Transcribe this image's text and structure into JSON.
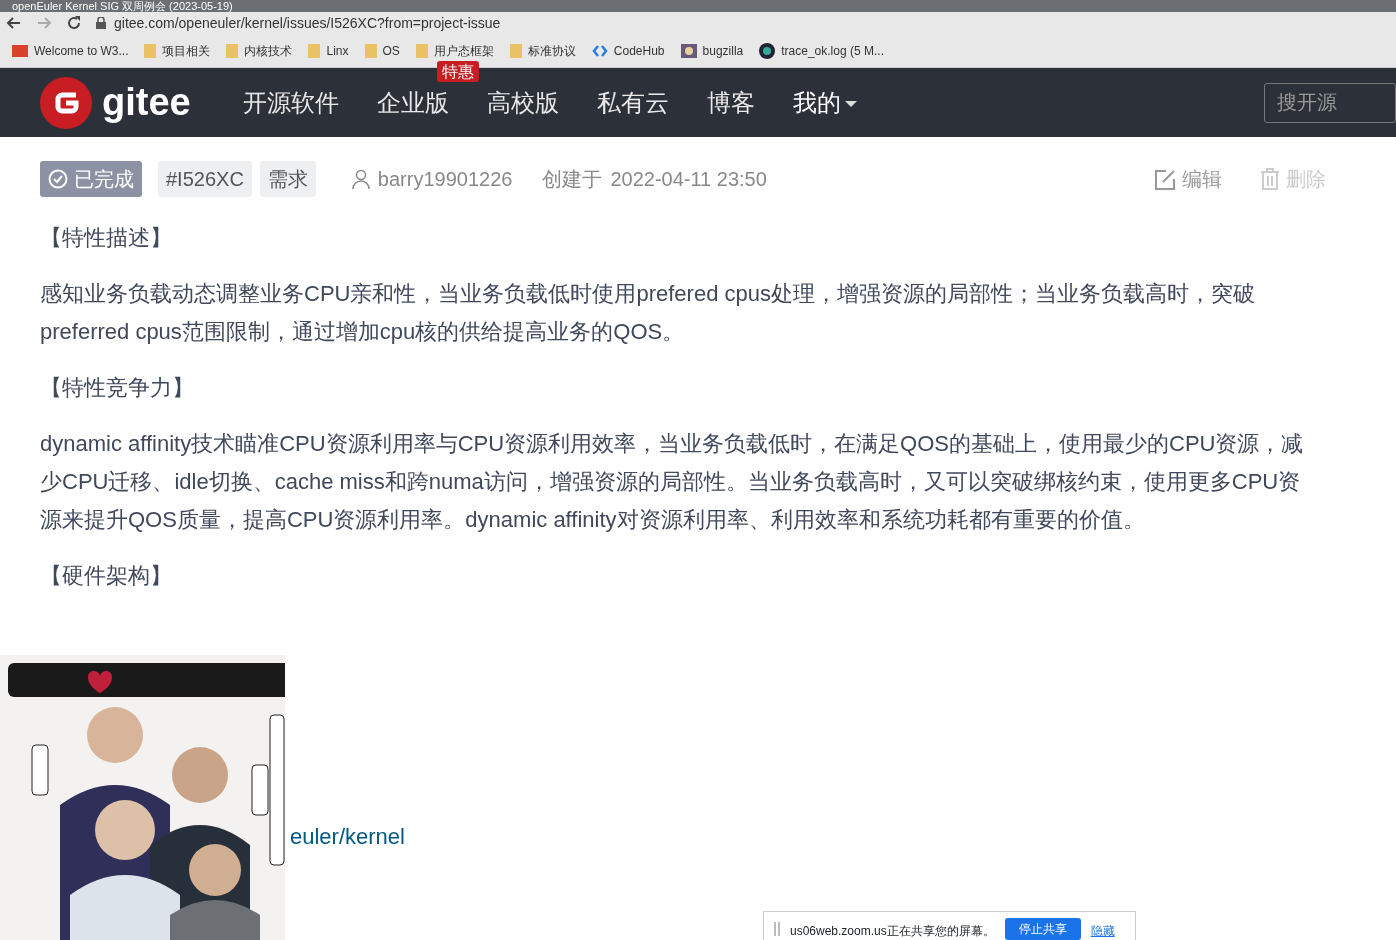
{
  "window": {
    "title": "openEuler Kernel SIG 双周例会 (2023-05-19)"
  },
  "browser": {
    "url": "gitee.com/openeuler/kernel/issues/I526XC?from=project-issue"
  },
  "bookmarks": [
    {
      "label": "Welcome to W3...",
      "kind": "w3"
    },
    {
      "label": "项目相关",
      "kind": "folder"
    },
    {
      "label": "内核技术",
      "kind": "folder"
    },
    {
      "label": "Linx",
      "kind": "folder"
    },
    {
      "label": "OS",
      "kind": "folder"
    },
    {
      "label": "用户态框架",
      "kind": "folder"
    },
    {
      "label": "标准协议",
      "kind": "folder"
    },
    {
      "label": "CodeHub",
      "kind": "codehub"
    },
    {
      "label": "bugzilla",
      "kind": "bug"
    },
    {
      "label": "trace_ok.log (5 M...",
      "kind": "globe"
    }
  ],
  "navbar": {
    "logo": "gitee",
    "items": [
      {
        "label": "开源软件",
        "dropdown": false
      },
      {
        "label": "企业版",
        "badge": "特惠",
        "dropdown": false
      },
      {
        "label": "高校版",
        "dropdown": false
      },
      {
        "label": "私有云",
        "dropdown": false
      },
      {
        "label": "博客",
        "dropdown": false
      },
      {
        "label": "我的",
        "dropdown": true
      }
    ],
    "search": {
      "placeholder": "搜开源"
    }
  },
  "issue": {
    "status": "已完成",
    "number": "#I526XC",
    "type": "需求",
    "author": "barry19901226",
    "created_label": "创建于",
    "created": "2022-04-11 23:50",
    "actions": [
      {
        "label": "编辑",
        "kind": "edit",
        "disabled": false
      },
      {
        "label": "删除",
        "kind": "delete",
        "disabled": true
      }
    ]
  },
  "body": [
    {
      "kind": "heading",
      "text": "【特性描述】"
    },
    {
      "kind": "para",
      "text": "感知业务负载动态调整业务CPU亲和性，当业务负载低时使用prefered cpus处理，增强资源的局部性；当业务负载高时，突破preferred cpus范围限制，通过增加cpu核的供给提高业务的QOS。"
    },
    {
      "kind": "heading",
      "text": "【特性竞争力】"
    },
    {
      "kind": "para",
      "text": "dynamic affinity技术瞄准CPU资源利用率与CPU资源利用效率，当业务负载低时，在满足QOS的基础上，使用最少的CPU资源，减少CPU迁移、idle切换、cache miss和跨numa访问，增强资源的局部性。当业务负载高时，又可以突破绑核约束，使用更多CPU资源来提升QOS质量，提高CPU资源利用率。dynamic affinity对资源利用率、利用效率和系统功耗都有重要的价值。"
    },
    {
      "kind": "heading",
      "text": "【硬件架构】"
    }
  ],
  "repo_link": "euler/kernel",
  "share_bar": {
    "message": "us06web.zoom.us正在共享您的屏幕。",
    "stop": "停止共享",
    "hide": "隐藏"
  }
}
